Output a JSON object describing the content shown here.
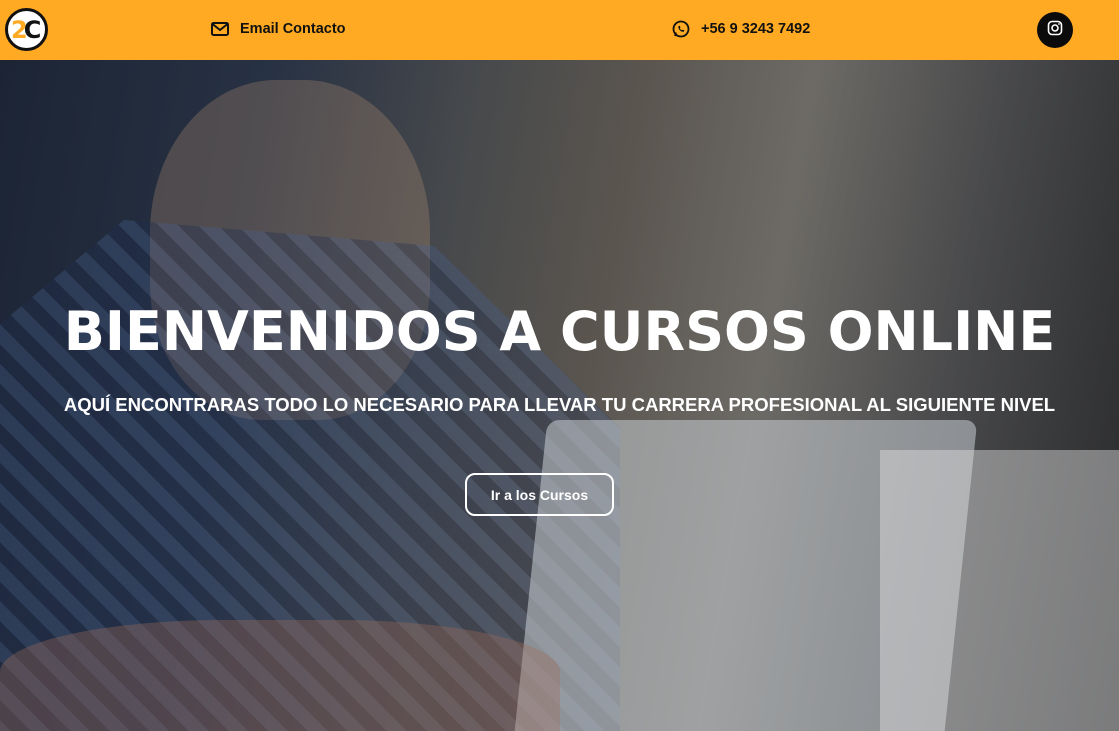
{
  "header": {
    "logo": {
      "text_2": "2",
      "text_c": "C"
    },
    "email_label": "Email Contacto",
    "phone_label": "+56 9 3243 7492",
    "icons": {
      "email": "mail-icon",
      "phone": "whatsapp-icon",
      "social": "instagram-icon"
    }
  },
  "hero": {
    "title": "BIENVENIDOS A CURSOS ONLINE",
    "subtitle": "AQUÍ ENCONTRARAS TODO LO NECESARIO PARA LLEVAR TU CARRERA PROFESIONAL AL SIGUIENTE NIVEL",
    "button_label": "Ir a los Cursos"
  },
  "colors": {
    "topbar": "#ffaa22",
    "text_dark": "#111111",
    "text_light": "#ffffff",
    "insta_bg": "#0b0b0b"
  }
}
